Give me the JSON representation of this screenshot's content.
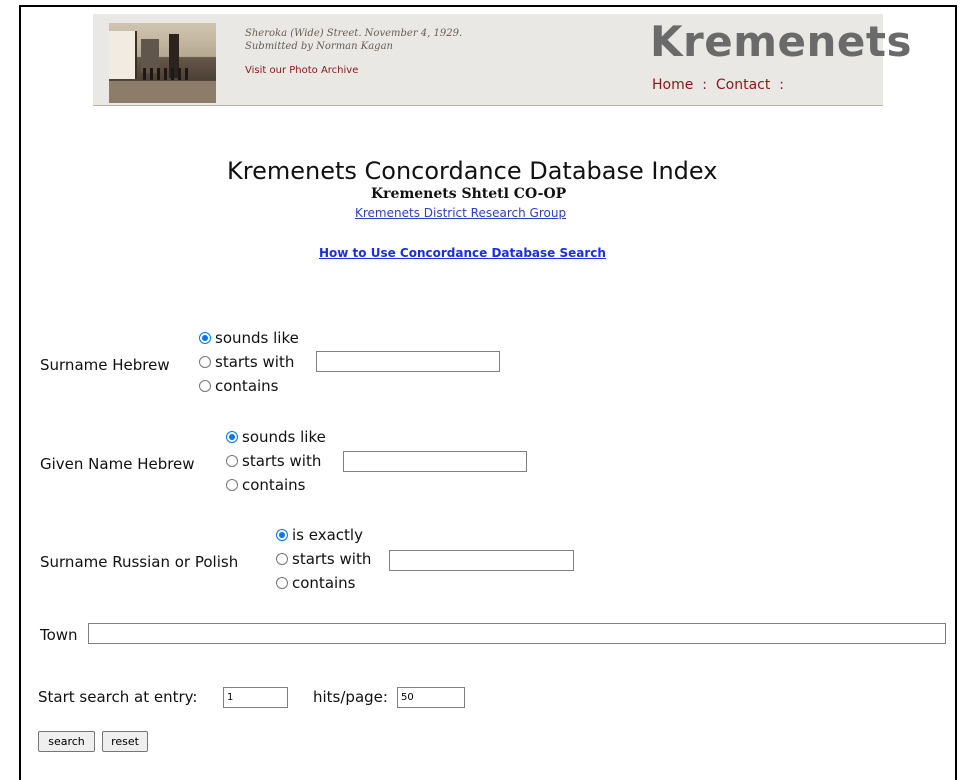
{
  "header": {
    "caption_line1": "Sheroka (Wide) Street. November 4, 1929.",
    "caption_line2": "Submitted by Norman Kagan",
    "archive_link": "Visit our Photo Archive",
    "site_title": "Kremenets",
    "nav": {
      "home": "Home",
      "separator": ":",
      "contact": "Contact"
    }
  },
  "main": {
    "title": "Kremenets Concordance Database Index",
    "subtitle": "Kremenets Shtetl CO-OP",
    "district_link": "Kremenets District Research Group",
    "howto_link": "How to Use Concordance Database Search"
  },
  "form": {
    "surname_hebrew": {
      "label": "Surname Hebrew",
      "options": [
        "sounds like",
        "starts with",
        "contains"
      ],
      "selected": "sounds like",
      "value": ""
    },
    "given_name_hebrew": {
      "label": "Given Name Hebrew",
      "options": [
        "sounds like",
        "starts with",
        "contains"
      ],
      "selected": "sounds like",
      "value": ""
    },
    "surname_russian_polish": {
      "label": "Surname Russian or Polish",
      "options": [
        "is exactly",
        "starts with",
        "contains"
      ],
      "selected": "is exactly",
      "value": ""
    },
    "town": {
      "label": "Town",
      "value": ""
    },
    "start_entry": {
      "label": "Start search at entry:",
      "value": "1"
    },
    "hits_page": {
      "label": "hits/page:",
      "value": "50"
    },
    "search_button": "search",
    "reset_button": "reset"
  },
  "colors": {
    "nav_link": "#8b1818",
    "link": "#1a2ee5",
    "radio_selected": "#0075ff"
  }
}
